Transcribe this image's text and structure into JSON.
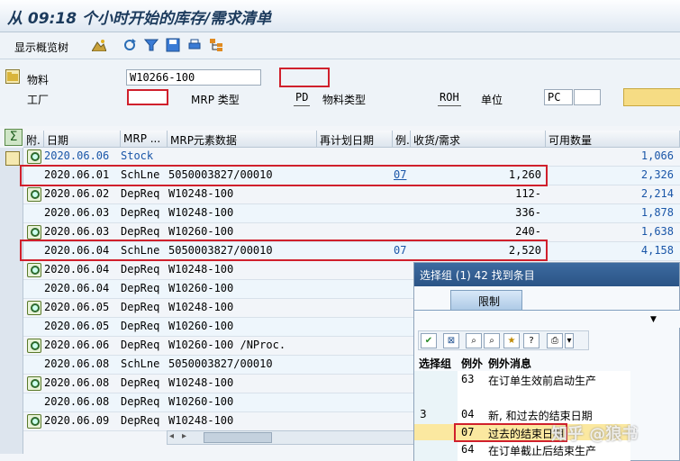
{
  "title": "从 09:18 个小时开始的库存/需求清单",
  "toolbar": {
    "overview_tree": "显示概览树",
    "icons": [
      "mountain-icon",
      "refresh-icon",
      "filter-icon",
      "save-icon",
      "print-icon",
      "hierarchy-icon"
    ]
  },
  "header": {
    "material_label": "物料",
    "material_value": "W10266-100",
    "plant_label": "工厂",
    "plant_value": "",
    "mrp_type_label": "MRP 类型",
    "mrp_type_value": "PD",
    "material_type_label": "物料类型",
    "material_type_value": "ROH",
    "unit_label": "单位",
    "unit_value": "PC"
  },
  "columns": [
    "附.",
    "日期",
    "MRP ...",
    "MRP元素数据",
    "再计划日期",
    "例.",
    "收货/需求",
    "可用数量"
  ],
  "rows": [
    {
      "date": "2020.06.06",
      "mrp": "Stock",
      "data": "",
      "exc": "",
      "qty": "",
      "avail": "1,066",
      "blue": true
    },
    {
      "date": "2020.06.01",
      "mrp": "SchLne",
      "data": "5050003827/00010",
      "exc": "07",
      "qty": "1,260",
      "avail": "2,326"
    },
    {
      "date": "2020.06.02",
      "mrp": "DepReq",
      "data": "W10248-100",
      "exc": "",
      "qty": "112-",
      "avail": "2,214"
    },
    {
      "date": "2020.06.03",
      "mrp": "DepReq",
      "data": "W10248-100",
      "exc": "",
      "qty": "336-",
      "avail": "1,878"
    },
    {
      "date": "2020.06.03",
      "mrp": "DepReq",
      "data": "W10260-100",
      "exc": "",
      "qty": "240-",
      "avail": "1,638"
    },
    {
      "date": "2020.06.04",
      "mrp": "SchLne",
      "data": "5050003827/00010",
      "exc": "07",
      "qty": "2,520",
      "avail": "4,158"
    },
    {
      "date": "2020.06.04",
      "mrp": "DepReq",
      "data": "W10248-100",
      "exc": "",
      "qty": "",
      "avail": ""
    },
    {
      "date": "2020.06.04",
      "mrp": "DepReq",
      "data": "W10260-100",
      "exc": "",
      "qty": "",
      "avail": ""
    },
    {
      "date": "2020.06.05",
      "mrp": "DepReq",
      "data": "W10248-100",
      "exc": "",
      "qty": "",
      "avail": ""
    },
    {
      "date": "2020.06.05",
      "mrp": "DepReq",
      "data": "W10260-100",
      "exc": "",
      "qty": "",
      "avail": ""
    },
    {
      "date": "2020.06.06",
      "mrp": "DepReq",
      "data": "W10260-100 /NProc.",
      "exc": "",
      "qty": "",
      "avail": ""
    },
    {
      "date": "2020.06.08",
      "mrp": "SchLne",
      "data": "5050003827/00010",
      "exc": "",
      "qty": "",
      "avail": ""
    },
    {
      "date": "2020.06.08",
      "mrp": "DepReq",
      "data": "W10248-100",
      "exc": "",
      "qty": "",
      "avail": ""
    },
    {
      "date": "2020.06.08",
      "mrp": "DepReq",
      "data": "W10260-100",
      "exc": "",
      "qty": "",
      "avail": ""
    },
    {
      "date": "2020.06.09",
      "mrp": "DepReq",
      "data": "W10248-100",
      "exc": "",
      "qty": "",
      "avail": ""
    }
  ],
  "popup": {
    "title": "选择组 (1)  42 找到条目",
    "tab": "限制",
    "col_group": "选择组",
    "col_exc": "例外",
    "col_msg": "例外消息",
    "items": [
      {
        "group": "",
        "exc": "63",
        "msg": "在订单生效前启动生产"
      },
      {
        "group": "3",
        "exc": "04",
        "msg": "新, 和过去的结束日期"
      },
      {
        "group": "",
        "exc": "07",
        "msg": "过去的结束日期"
      },
      {
        "group": "",
        "exc": "64",
        "msg": "在订单截止后结束生产"
      }
    ]
  },
  "watermark": "知乎 @狼书"
}
